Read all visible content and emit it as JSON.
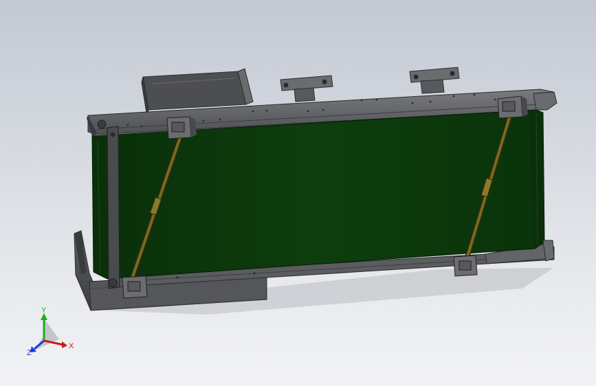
{
  "viewport": {
    "background_top": "#c3c8d2",
    "background_bottom": "#f2f3f5"
  },
  "model": {
    "frame_color": "#5e5f62",
    "belt_color": "#0c3a0c",
    "strut_color": "#7a6a1e",
    "hole_color": "#2a2b2d"
  },
  "triad": {
    "x_label": "X",
    "y_label": "Y",
    "z_label": "Z",
    "x_color": "#d01818",
    "y_color": "#18b018",
    "z_color": "#1838d8"
  }
}
